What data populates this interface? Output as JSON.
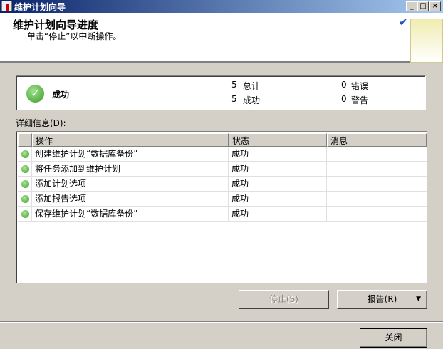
{
  "window": {
    "title": "维护计划向导"
  },
  "header": {
    "title": "维护计划向导进度",
    "subtitle": "单击“停止”以中断操作。"
  },
  "summary": {
    "status": "成功",
    "total_count": "5",
    "total_label": "总计",
    "success_count": "5",
    "success_label": "成功",
    "error_count": "0",
    "error_label": "错误",
    "warning_count": "0",
    "warning_label": "警告"
  },
  "details": {
    "label": "详细信息(D):",
    "columns": [
      "操作",
      "状态",
      "消息"
    ],
    "rows": [
      {
        "action": "创建维护计划“数据库备份”",
        "status": "成功",
        "message": ""
      },
      {
        "action": "将任务添加到维护计划",
        "status": "成功",
        "message": ""
      },
      {
        "action": "添加计划选项",
        "status": "成功",
        "message": ""
      },
      {
        "action": "添加报告选项",
        "status": "成功",
        "message": ""
      },
      {
        "action": "保存维护计划“数据库备份”",
        "status": "成功",
        "message": ""
      }
    ]
  },
  "buttons": {
    "stop": "停止(S)",
    "report": "报告(R)",
    "close": "关闭"
  },
  "colors": {
    "titlebar_start": "#0a246a",
    "titlebar_end": "#a6caf0",
    "success": "#3a9a2a"
  }
}
